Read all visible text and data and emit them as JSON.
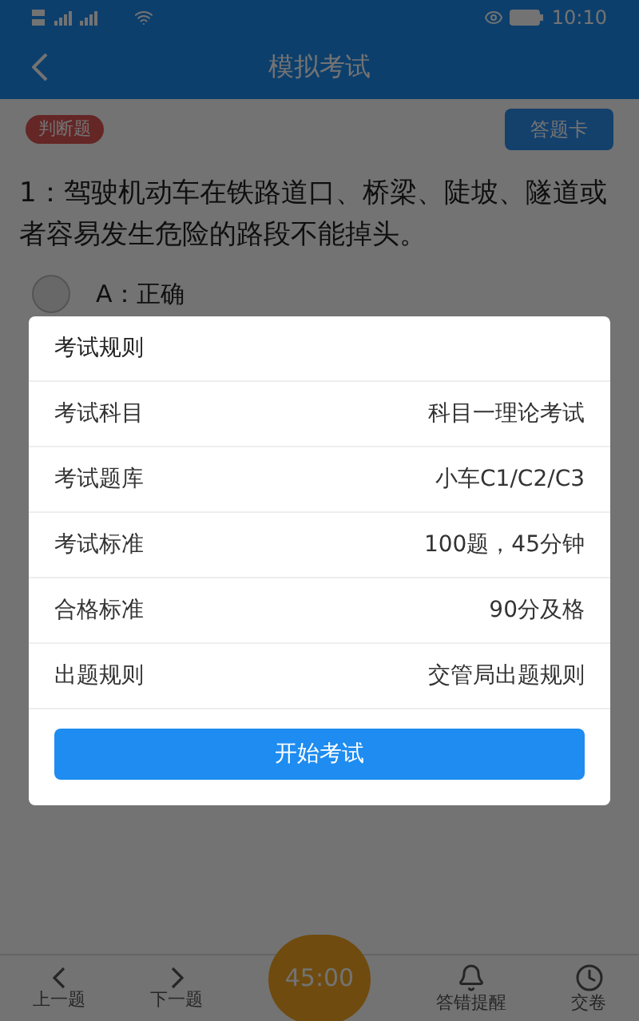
{
  "status_bar": {
    "time": "10:10"
  },
  "header": {
    "title": "模拟考试"
  },
  "question_type": "判断题",
  "answer_card_button": "答题卡",
  "question": "1：驾驶机动车在铁路道口、桥梁、陡坡、隧道或者容易发生危险的路段不能掉头。",
  "options": [
    {
      "label": "A：正确",
      "selected": false
    }
  ],
  "dialog": {
    "title": "考试规则",
    "rows": [
      {
        "label": "考试科目",
        "value": "科目一理论考试"
      },
      {
        "label": "考试题库",
        "value": "小车C1/C2/C3"
      },
      {
        "label": "考试标准",
        "value": "100题，45分钟"
      },
      {
        "label": "合格标准",
        "value": "90分及格"
      },
      {
        "label": "出题规则",
        "value": "交管局出题规则"
      }
    ],
    "button": "开始考试"
  },
  "bottom_nav": [
    {
      "kind": "prev",
      "label": "上一题"
    },
    {
      "kind": "next",
      "label": "下一题"
    },
    {
      "kind": "timer",
      "label": "45:00"
    },
    {
      "kind": "remind",
      "label": "答错提醒"
    },
    {
      "kind": "submit",
      "label": "交卷"
    }
  ]
}
